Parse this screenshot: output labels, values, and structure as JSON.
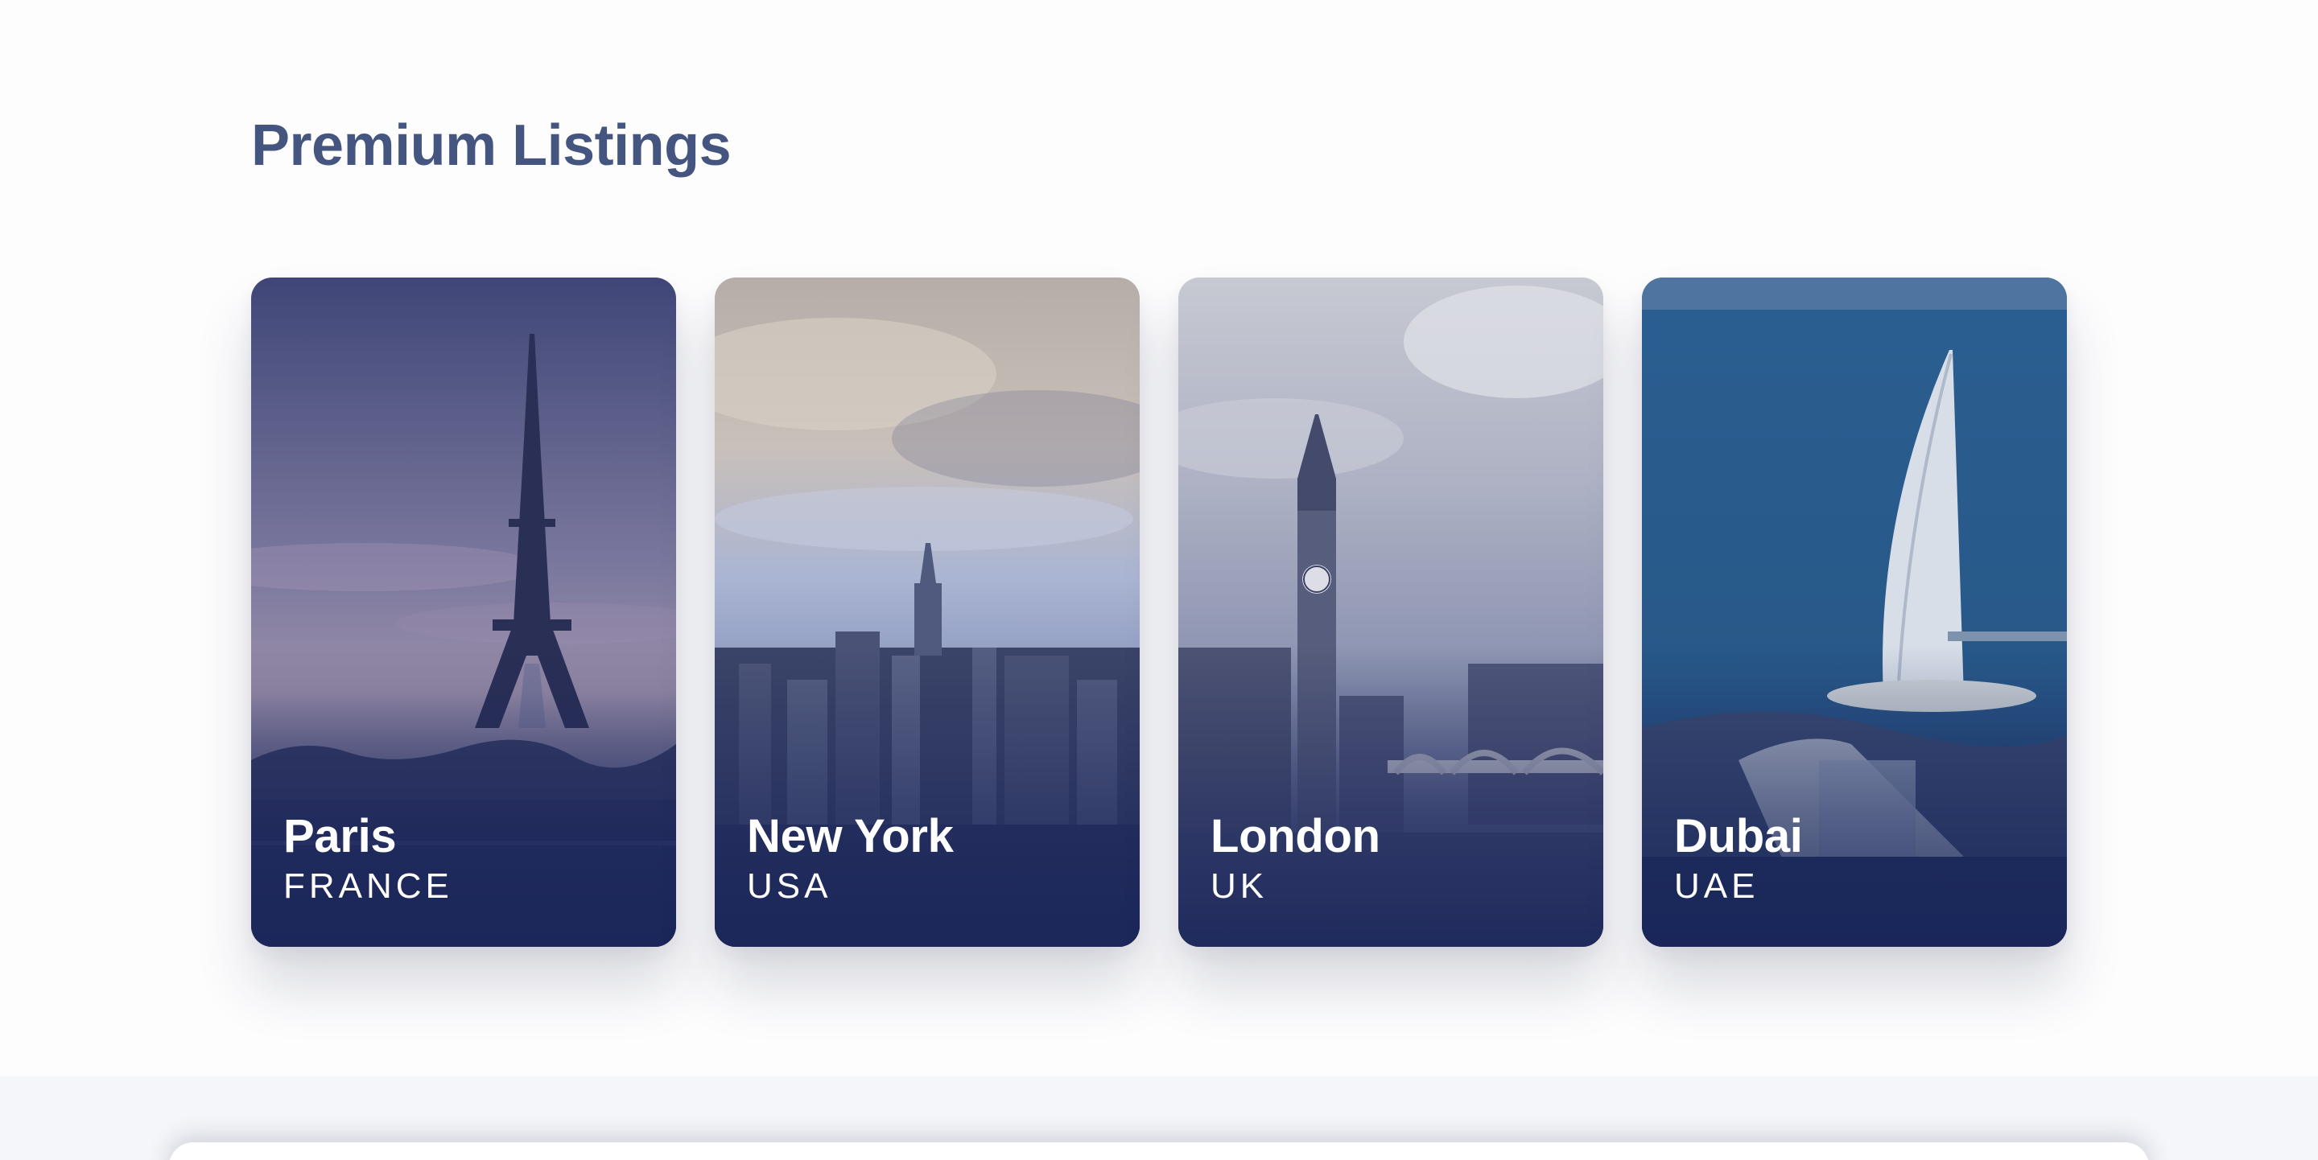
{
  "section": {
    "title": "Premium Listings"
  },
  "cards": [
    {
      "city": "Paris",
      "country": "FRANCE",
      "image": "eiffel-tower-image"
    },
    {
      "city": "New York",
      "country": "USA",
      "image": "new-york-skyline-image"
    },
    {
      "city": "London",
      "country": "UK",
      "image": "big-ben-image"
    },
    {
      "city": "Dubai",
      "country": "UAE",
      "image": "burj-al-arab-image"
    }
  ],
  "colors": {
    "title": "#44557f",
    "overlay": "#1a265a",
    "card_text": "#ffffff",
    "footer_band": "#f5f6fa"
  }
}
